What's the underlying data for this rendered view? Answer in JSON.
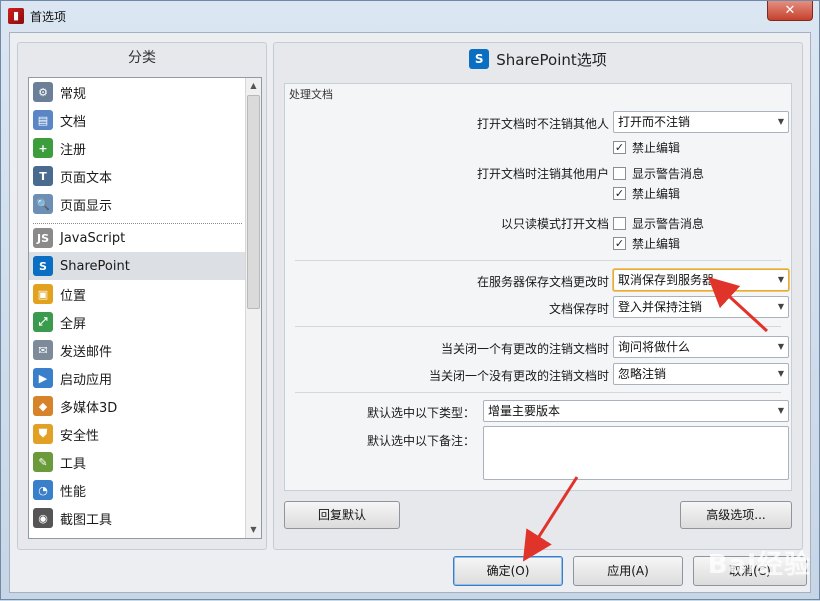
{
  "window": {
    "title": "首选项",
    "close_label": "✕"
  },
  "left": {
    "header": "分类",
    "items": [
      {
        "label": "常规",
        "icon": "settings-doc-icon",
        "color": "#6b7f99"
      },
      {
        "label": "文档",
        "icon": "document-icon",
        "color": "#5a86c5"
      },
      {
        "label": "注册",
        "icon": "user-add-icon",
        "color": "#3b9d3b"
      },
      {
        "label": "页面文本",
        "icon": "text-icon",
        "color": "#4a6a90"
      },
      {
        "label": "页面显示",
        "icon": "page-search-icon",
        "color": "#6d8fb5"
      },
      {
        "label": "JavaScript",
        "icon": "script-icon",
        "color": "#8a8a8a"
      },
      {
        "label": "SharePoint",
        "icon": "sharepoint-icon",
        "color": "#0a6fc2"
      },
      {
        "label": "位置",
        "icon": "folder-icon",
        "color": "#e3a21e"
      },
      {
        "label": "全屏",
        "icon": "fullscreen-icon",
        "color": "#3a9a4d"
      },
      {
        "label": "发送邮件",
        "icon": "mail-icon",
        "color": "#7d8a99"
      },
      {
        "label": "启动应用",
        "icon": "launch-icon",
        "color": "#3a7fc9"
      },
      {
        "label": "多媒体3D",
        "icon": "multimedia-icon",
        "color": "#d6832a"
      },
      {
        "label": "安全性",
        "icon": "shield-icon",
        "color": "#e2a024"
      },
      {
        "label": "工具",
        "icon": "tools-icon",
        "color": "#6a9a3a"
      },
      {
        "label": "性能",
        "icon": "gauge-icon",
        "color": "#3a7fc9"
      },
      {
        "label": "截图工具",
        "icon": "camera-icon",
        "color": "#555"
      }
    ]
  },
  "right": {
    "header": "SharePoint选项",
    "group_title": "处理文档",
    "checkout_other": {
      "label": "打开文档时不注销其他人",
      "value": "打开而不注销",
      "disable_edit": "禁止编辑"
    },
    "checkout_by_other": {
      "label": "打开文档时注销其他用户",
      "show_warning": "显示警告消息",
      "disable_edit": "禁止编辑"
    },
    "readonly": {
      "label": "以只读模式打开文档",
      "show_warning": "显示警告消息",
      "disable_edit": "禁止编辑"
    },
    "server_save": {
      "label": "在服务器保存文档更改时",
      "value": "取消保存到服务器"
    },
    "doc_save": {
      "label": "文档保存时",
      "value": "登入并保持注销"
    },
    "close_changed": {
      "label": "当关闭一个有更改的注销文档时",
      "value": "询问将做什么"
    },
    "close_unchanged": {
      "label": "当关闭一个没有更改的注销文档时",
      "value": "忽略注销"
    },
    "default_type": {
      "label": "默认选中以下类型：",
      "value": "增量主要版本"
    },
    "default_note": {
      "label": "默认选中以下备注："
    },
    "restore_button": "回复默认",
    "advanced_button": "高级选项..."
  },
  "footer": {
    "ok": "确定(O)",
    "apply": "应用(A)",
    "cancel": "取消(C)"
  },
  "watermark": "Bai经验",
  "colors": {
    "sharepoint": "#0a6fc2",
    "annotation": "#e0332a"
  }
}
